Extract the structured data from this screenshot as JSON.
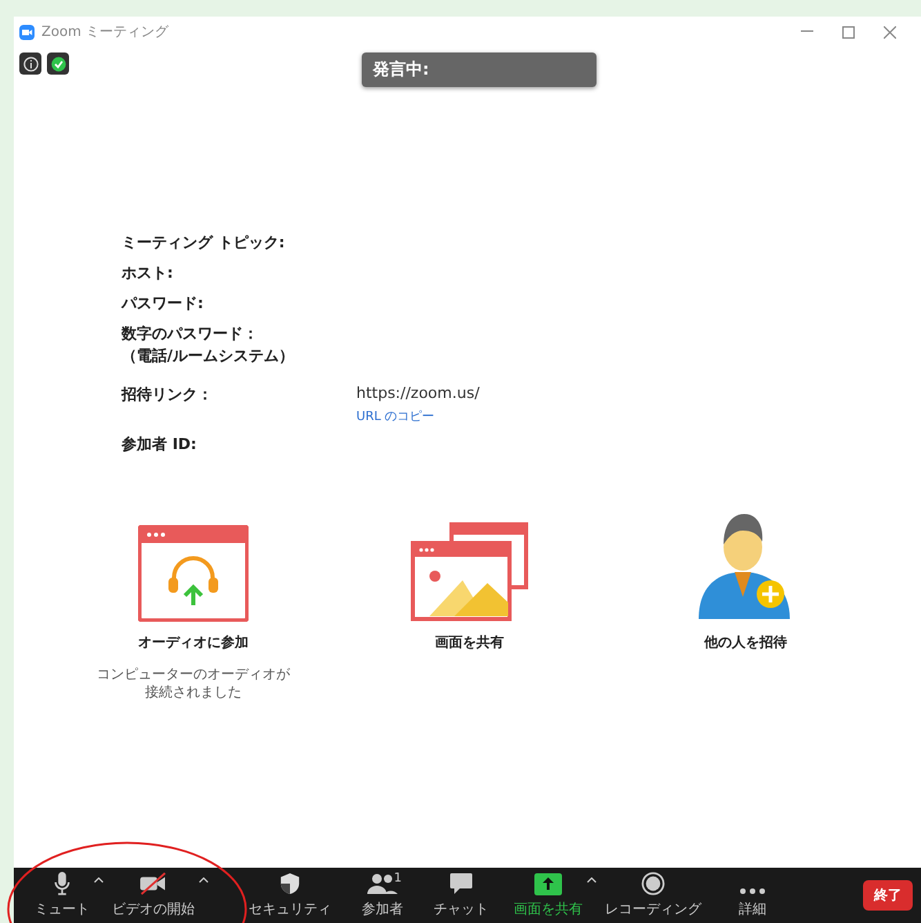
{
  "window": {
    "title": "Zoom ミーティング"
  },
  "speaking_label": "発言中:",
  "meeting_info": [
    {
      "label": "ミーティング トピック:"
    },
    {
      "label": "ホスト:"
    },
    {
      "label": "パスワード:"
    },
    {
      "label": "数字のパスワード：",
      "sub_label": "（電話/ルームシステム）"
    },
    {
      "label": "招待リンク：",
      "value": "https://zoom.us/",
      "link": "URL のコピー"
    },
    {
      "label": "参加者 ID:"
    }
  ],
  "actions": [
    {
      "kind": "audio",
      "label": "オーディオに参加",
      "note_lines": [
        "コンピューターのオーディオが",
        "接続されました"
      ]
    },
    {
      "kind": "share",
      "label": "画面を共有"
    },
    {
      "kind": "invite",
      "label": "他の人を招待"
    }
  ],
  "toolbar": [
    {
      "kind": "mic",
      "label": "ミュート",
      "caret": true,
      "on": true
    },
    {
      "kind": "video",
      "label": "ビデオの開始",
      "caret": true,
      "on": false
    },
    {
      "kind": "security",
      "label": "セキュリティ",
      "caret": false
    },
    {
      "kind": "participants",
      "label": "参加者",
      "caret": false,
      "badge": "1"
    },
    {
      "kind": "chat",
      "label": "チャット",
      "caret": false
    },
    {
      "kind": "share",
      "label": "画面を共有",
      "caret": true,
      "highlighted": true
    },
    {
      "kind": "record",
      "label": "レコーディング",
      "caret": false
    },
    {
      "kind": "more",
      "label": "詳細",
      "caret": false
    }
  ],
  "end_button": "終了"
}
